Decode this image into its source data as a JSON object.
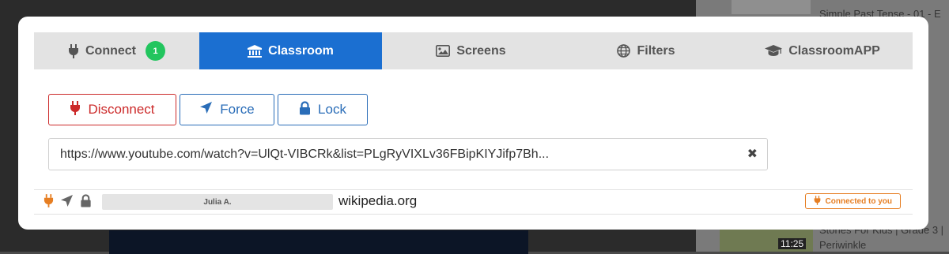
{
  "background": {
    "right_list": [
      "Simple Past Tense - 01 - E",
      "Periwinkle",
      "Stories For Kids | Grade 3 |"
    ],
    "video_duration": "11:25"
  },
  "tabs": [
    {
      "label": "Connect",
      "icon": "plug-icon",
      "badge": "1",
      "active": false
    },
    {
      "label": "Classroom",
      "icon": "bank-icon",
      "active": true
    },
    {
      "label": "Screens",
      "icon": "image-icon",
      "active": false
    },
    {
      "label": "Filters",
      "icon": "globe-icon",
      "active": false
    },
    {
      "label": "ClassroomAPP",
      "icon": "graduation-cap-icon",
      "active": false
    }
  ],
  "actions": {
    "disconnect": "Disconnect",
    "force": "Force",
    "lock": "Lock"
  },
  "url_input": {
    "value": "https://www.youtube.com/watch?v=UlQt-VIBCRk&list=PLgRyVIXLv36FBipKIYJifp7Bh...",
    "clear_symbol": "✖"
  },
  "student": {
    "name": "Julia A.",
    "site": "wikipedia.org",
    "status": "Connected to you"
  },
  "colors": {
    "accent_blue": "#1b6fd1",
    "danger_red": "#cc2a2a",
    "status_orange": "#e67e22",
    "badge_green": "#22c55e"
  }
}
